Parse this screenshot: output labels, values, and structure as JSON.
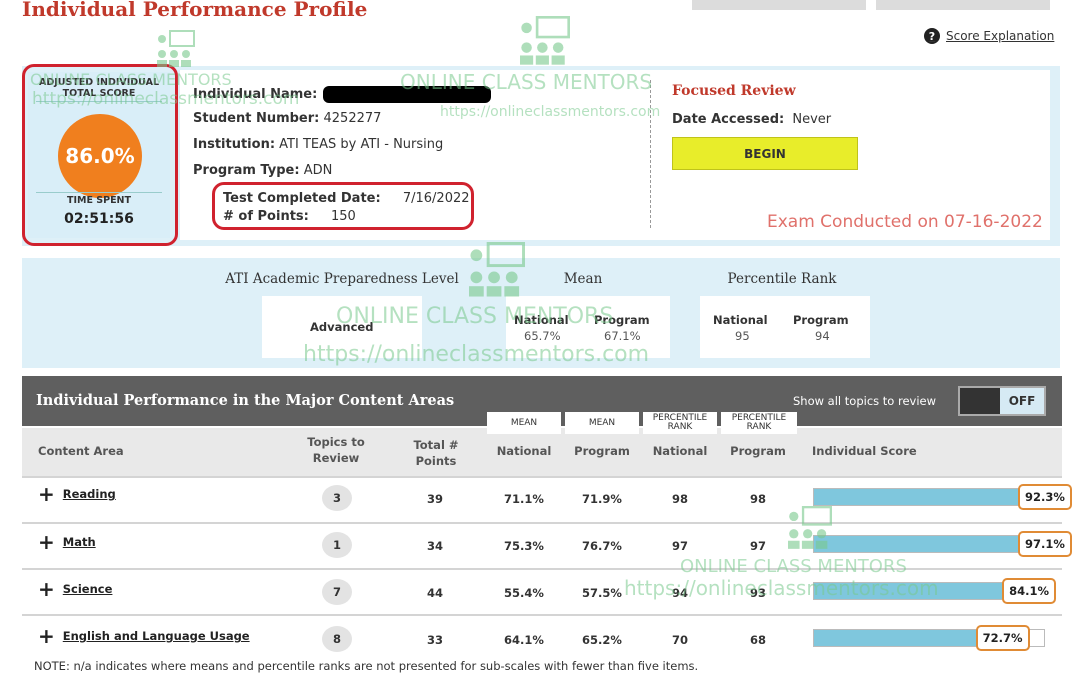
{
  "page": {
    "title": "Individual Performance Profile",
    "score_explanation": "Score Explanation"
  },
  "score_box": {
    "label": "ADJUSTED INDIVIDUAL TOTAL SCORE",
    "score": "86.0%",
    "time_label": "TIME SPENT",
    "time": "02:51:56"
  },
  "individual": {
    "name_label": "Individual Name:",
    "student_number_label": "Student Number:",
    "student_number": "4252277",
    "institution_label": "Institution:",
    "institution": "ATI TEAS by ATI - Nursing",
    "program_type_label": "Program Type:",
    "program_type": "ADN",
    "test_completed_label": "Test Completed Date:",
    "test_completed": "7/16/2022",
    "points_label": "# of Points:",
    "points": "150"
  },
  "focused_review": {
    "title": "Focused Review",
    "date_accessed_label": "Date Accessed:",
    "date_accessed": "Never",
    "begin_label": "BEGIN"
  },
  "exam_note": "Exam Conducted on 07-16-2022",
  "academic": {
    "level_heading": "ATI Academic Preparedness Level",
    "level_value": "Advanced",
    "mean_heading": "Mean",
    "mean_national_label": "National",
    "mean_national": "65.7%",
    "mean_program_label": "Program",
    "mean_program": "67.1%",
    "percentile_heading": "Percentile Rank",
    "pct_national_label": "National",
    "pct_national": "95",
    "pct_program_label": "Program",
    "pct_program": "94"
  },
  "content_areas": {
    "title": "Individual Performance in the Major Content Areas",
    "show_all_label": "Show all topics to review",
    "toggle_label": "OFF",
    "tags": [
      "MEAN",
      "MEAN",
      "PERCENTILE RANK",
      "PERCENTILE RANK"
    ],
    "headers": {
      "content_area": "Content Area",
      "topics": "Topics to Review",
      "total_points": "Total # Points",
      "mean_national": "National",
      "mean_program": "Program",
      "pct_national": "National",
      "pct_program": "Program",
      "individual_score": "Individual Score"
    },
    "rows": [
      {
        "name": "Reading",
        "topics": "3",
        "points": "39",
        "mean_national": "71.1%",
        "mean_program": "71.9%",
        "pct_national": "98",
        "pct_program": "98",
        "score": "92.3%",
        "score_value": 92.3
      },
      {
        "name": "Math",
        "topics": "1",
        "points": "34",
        "mean_national": "75.3%",
        "mean_program": "76.7%",
        "pct_national": "97",
        "pct_program": "97",
        "score": "97.1%",
        "score_value": 97.1
      },
      {
        "name": "Science",
        "topics": "7",
        "points": "44",
        "mean_national": "55.4%",
        "mean_program": "57.5%",
        "pct_national": "94",
        "pct_program": "93",
        "score": "84.1%",
        "score_value": 84.1
      },
      {
        "name": "English and Language Usage",
        "topics": "8",
        "points": "33",
        "mean_national": "64.1%",
        "mean_program": "65.2%",
        "pct_national": "70",
        "pct_program": "68",
        "score": "72.7%",
        "score_value": 72.7
      }
    ],
    "note": "NOTE: n/a indicates where means and percentile ranks are not presented for sub-scales with fewer than five items."
  },
  "watermark": {
    "name": "ONLINE CLASS MENTORS",
    "url": "https://onlineclassmentors.com"
  },
  "colors": {
    "title_red": "#c0392b",
    "highlight_red": "#d0222e",
    "score_orange": "#f07f1e",
    "bar_blue": "#7fc7dd",
    "begin_yellow": "#e8ed2a"
  }
}
